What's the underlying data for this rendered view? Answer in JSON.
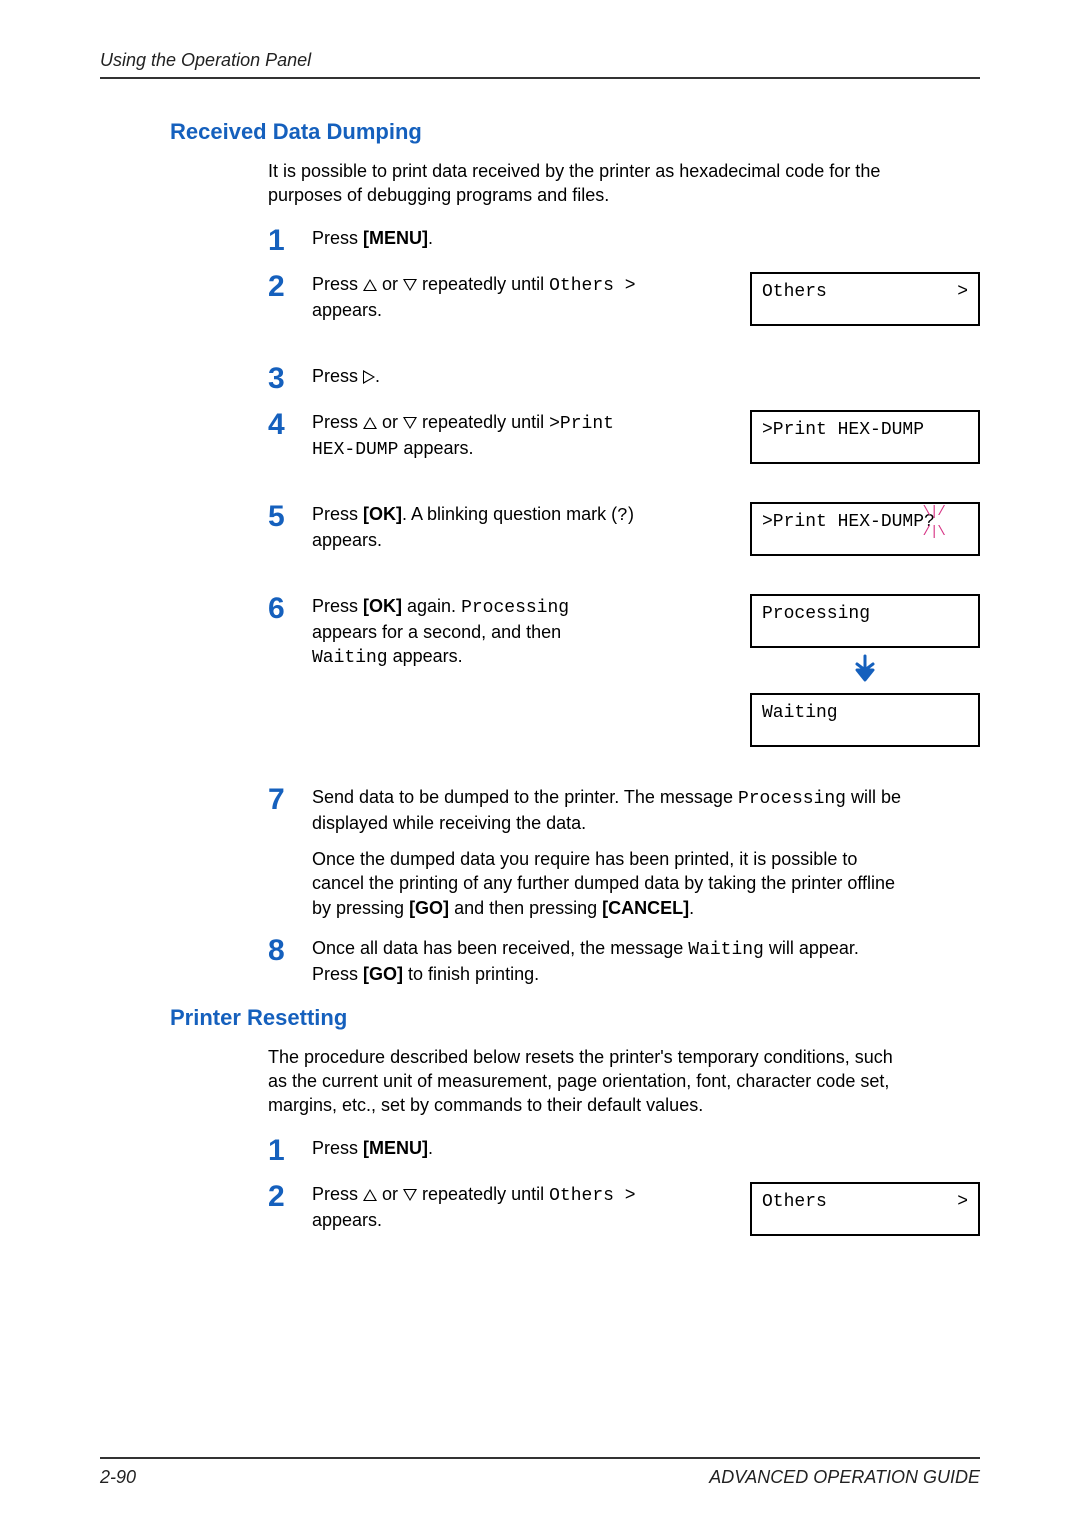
{
  "header": "Using the Operation Panel",
  "section1": {
    "title": "Received Data Dumping",
    "intro": "It is possible to print data received by the printer as hexadecimal code for the purposes of debugging programs and files.",
    "steps": {
      "s1_a": "Press ",
      "s1_menu": "[MENU]",
      "s1_b": ".",
      "s2_a": "Press ",
      "s2_b": " or ",
      "s2_c": " repeatedly until ",
      "s2_code": "Others  >",
      "s2_d": " appears.",
      "lcd2_left": "Others",
      "lcd2_right": ">",
      "s3_a": "Press ",
      "s3_b": ".",
      "s4_a": "Press ",
      "s4_b": " or ",
      "s4_c": " repeatedly until ",
      "s4_code": ">Print HEX-DUMP",
      "s4_d": " appears.",
      "lcd4": ">Print HEX-DUMP",
      "s5_a": "Press ",
      "s5_ok": "[OK]",
      "s5_b": ". A blinking question mark (",
      "s5_q": "?",
      "s5_c": ") appears.",
      "lcd5a": ">Print HEX-DUMP",
      "lcd5b": "?",
      "s6_a": "Press ",
      "s6_ok": "[OK]",
      "s6_b": " again. ",
      "s6_proc": "Processing",
      "s6_c": " appears for a second, and then ",
      "s6_wait": "Waiting",
      "s6_d": " appears.",
      "lcd6a": "Processing",
      "lcd6b": "Waiting",
      "s7_a": "Send data to be dumped to the printer. The message ",
      "s7_proc": "Processing",
      "s7_b": " will be displayed while receiving the data.",
      "s7_para_a": "Once the dumped data you require has been printed, it is possible to cancel the printing of any further dumped data by taking the printer offline by pressing ",
      "s7_go": "[GO]",
      "s7_para_b": " and then pressing ",
      "s7_cancel": "[CANCEL]",
      "s7_para_c": ".",
      "s8_a": "Once all data has been received, the message ",
      "s8_wait": "Waiting",
      "s8_b": " will appear. Press ",
      "s8_go": "[GO]",
      "s8_c": " to finish printing."
    },
    "nums": {
      "n1": "1",
      "n2": "2",
      "n3": "3",
      "n4": "4",
      "n5": "5",
      "n6": "6",
      "n7": "7",
      "n8": "8"
    }
  },
  "section2": {
    "title": "Printer Resetting",
    "intro": "The procedure described below resets the printer's temporary conditions, such as the current unit of measurement, page orientation, font, character code set, margins, etc., set by commands to their default values.",
    "steps": {
      "s1_a": "Press ",
      "s1_menu": "[MENU]",
      "s1_b": ".",
      "s2_a": "Press ",
      "s2_b": " or ",
      "s2_c": " repeatedly until ",
      "s2_code": "Others  >",
      "s2_d": " appears.",
      "lcd2_left": "Others",
      "lcd2_right": ">"
    },
    "nums": {
      "n1": "1",
      "n2": "2"
    }
  },
  "footer": {
    "left": "2-90",
    "right": "ADVANCED OPERATION GUIDE"
  }
}
